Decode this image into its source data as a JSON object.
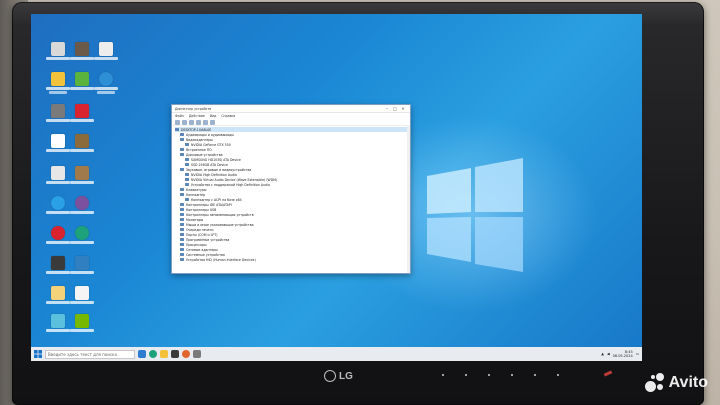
{
  "window": {
    "title": "Диспетчер устройств",
    "controls": [
      "–",
      "□",
      "×"
    ],
    "menu": [
      "Файл",
      "Действие",
      "Вид",
      "Справка"
    ],
    "tree": [
      {
        "label": "DESKTOP-1OA6L0E",
        "level": 0,
        "selected": true
      },
      {
        "label": "Аудиовходы и аудиовыходы",
        "level": 1
      },
      {
        "label": "Видеоадаптеры",
        "level": 1
      },
      {
        "label": "NVIDIA GeForce GTX 550",
        "level": 2
      },
      {
        "label": "Встроенное ПО",
        "level": 1
      },
      {
        "label": "Дисковые устройства",
        "level": 1
      },
      {
        "label": "SAMSUNG HD103SJ ATA Device",
        "level": 2
      },
      {
        "label": "SSD 256GB ATA Device",
        "level": 2
      },
      {
        "label": "Звуковые, игровые и видеоустройства",
        "level": 1
      },
      {
        "label": "NVIDIA High Definition Audio",
        "level": 2
      },
      {
        "label": "NVIDIA Virtual Audio Device (Wave Extensible) (WDM)",
        "level": 2
      },
      {
        "label": "Устройство с поддержкой High Definition Audio",
        "level": 2
      },
      {
        "label": "Клавиатуры",
        "level": 1
      },
      {
        "label": "Компьютер",
        "level": 1
      },
      {
        "label": "Компьютер с ACPI на базе x64",
        "level": 2
      },
      {
        "label": "Контроллеры IDE ATA/ATAPI",
        "level": 1
      },
      {
        "label": "Контроллеры USB",
        "level": 1
      },
      {
        "label": "Контроллеры запоминающих устройств",
        "level": 1
      },
      {
        "label": "Мониторы",
        "level": 1
      },
      {
        "label": "Мыши и иные указывающие устройства",
        "level": 1
      },
      {
        "label": "Очереди печати",
        "level": 1
      },
      {
        "label": "Порты (COM и LPT)",
        "level": 1
      },
      {
        "label": "Программные устройства",
        "level": 1
      },
      {
        "label": "Процессоры",
        "level": 1
      },
      {
        "label": "Сетевые адаптеры",
        "level": 1
      },
      {
        "label": "Системные устройства",
        "level": 1
      },
      {
        "label": "Устройства HID (Human Interface Devices)",
        "level": 1
      }
    ]
  },
  "taskbar": {
    "search_placeholder": "Введите здесь текст для поиска",
    "time": "8:45",
    "date": "08.05.2024"
  },
  "monitor": {
    "brand": "LG"
  },
  "watermark": {
    "text": "Avito"
  },
  "colors": {
    "wallpaper": "#1a86d4",
    "bezel": "#1a1a1c",
    "accent": "#5c86b8"
  }
}
